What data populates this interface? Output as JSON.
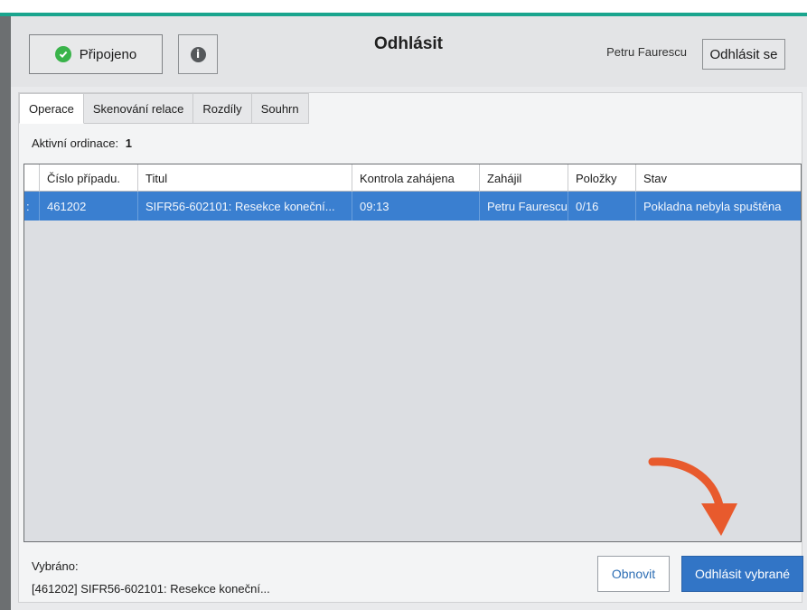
{
  "header": {
    "status_label": "Připojeno",
    "title": "Odhlásit",
    "user_name": "Petru Faurescu",
    "logout_label": "Odhlásit se"
  },
  "tabs": [
    {
      "label": "Operace",
      "active": true
    },
    {
      "label": "Skenování relace",
      "active": false
    },
    {
      "label": "Rozdíly",
      "active": false
    },
    {
      "label": "Souhrn",
      "active": false
    }
  ],
  "active_operations": {
    "label": "Aktivní ordinace:",
    "count": "1"
  },
  "table": {
    "columns": [
      "Číslo případu.",
      "Titul",
      "Kontrola zahájena",
      "Zahájil",
      "Položky",
      "Stav"
    ],
    "rows": [
      [
        "461202",
        "SIFR56-602101: Resekce koneční...",
        "09:13",
        "Petru Faurescu",
        "0/16",
        "Pokladna nebyla spuštěna"
      ]
    ]
  },
  "footer": {
    "selected_label": "Vybráno:",
    "selected_value": "[461202] SIFR56-602101: Resekce koneční...",
    "refresh_label": "Obnovit",
    "logout_selected_label": "Odhlásit vybrané"
  },
  "colors": {
    "accent": "#3275c6",
    "teal_bar": "#1aa58e",
    "status_ok": "#39b34a",
    "annotation_arrow": "#e85a2d",
    "selected_row": "#3a7fd0"
  }
}
